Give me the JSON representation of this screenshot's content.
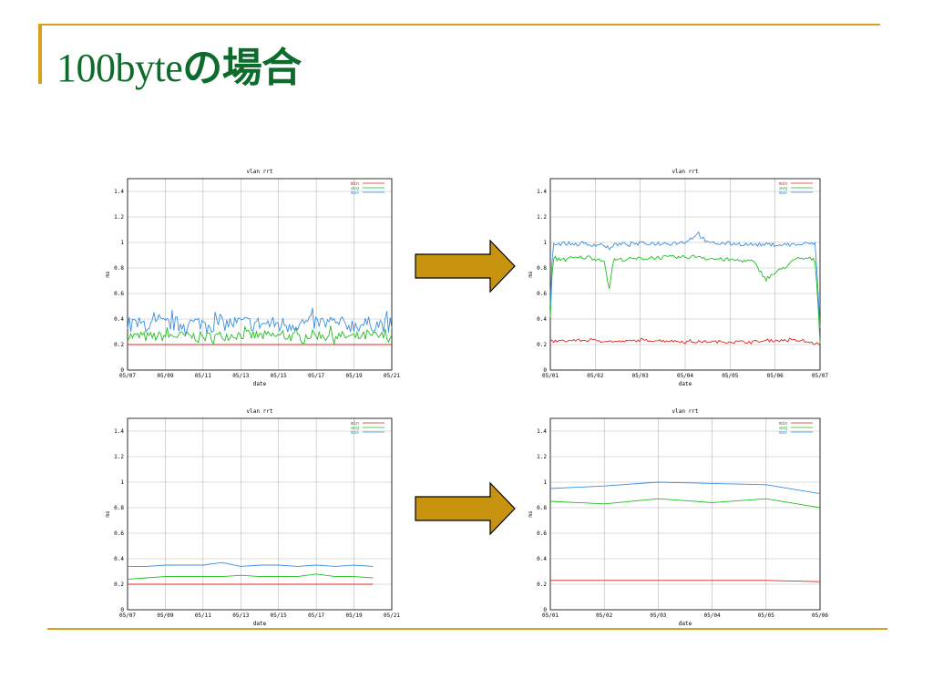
{
  "slide": {
    "title_latin": "100byte",
    "title_jp": "の場合"
  },
  "colors": {
    "accent": "#d6a21e",
    "title": "#0d6b2c",
    "arrow_fill": "#c8940f",
    "min": "#e0241f",
    "avg": "#1fbf1f",
    "max": "#3a8fe0"
  },
  "chart_data": [
    {
      "id": "top-left",
      "type": "line",
      "title": "vlan rrt",
      "xlabel": "date",
      "ylabel": "ms",
      "ylim": [
        0,
        1.5
      ],
      "yticks": [
        "0",
        "0.2",
        "0.4",
        "0.6",
        "0.8",
        "1",
        "1.2",
        "1.4"
      ],
      "xticks": [
        "05/07",
        "05/09",
        "05/11",
        "05/13",
        "05/15",
        "05/17",
        "05/19",
        "05/21"
      ],
      "xlim": [
        0,
        14
      ],
      "legend": [
        "min",
        "avg",
        "max"
      ],
      "legend_position": "top-right",
      "grid": true,
      "noisy": true,
      "series": [
        {
          "name": "min",
          "x": [
            0,
            14
          ],
          "values": [
            0.2,
            0.2
          ]
        },
        {
          "name": "avg",
          "x": [
            0,
            1,
            2,
            3,
            4,
            5,
            6,
            7,
            8,
            9,
            10,
            11,
            12,
            13,
            14
          ],
          "values": [
            0.26,
            0.25,
            0.26,
            0.26,
            0.25,
            0.26,
            0.27,
            0.26,
            0.26,
            0.25,
            0.27,
            0.26,
            0.25,
            0.26,
            0.25
          ],
          "jitter": 0.04
        },
        {
          "name": "max",
          "x": [
            0,
            1,
            2,
            3,
            4,
            5,
            6,
            7,
            8,
            9,
            10,
            11,
            12,
            13,
            14
          ],
          "values": [
            0.35,
            0.34,
            0.35,
            0.35,
            0.36,
            0.35,
            0.36,
            0.35,
            0.35,
            0.35,
            0.36,
            0.35,
            0.34,
            0.35,
            0.34
          ],
          "jitter": 0.06
        }
      ]
    },
    {
      "id": "top-right",
      "type": "line",
      "title": "vlan rrt",
      "xlabel": "date",
      "ylabel": "ms",
      "ylim": [
        0,
        1.5
      ],
      "yticks": [
        "0",
        "0.2",
        "0.4",
        "0.6",
        "0.8",
        "1",
        "1.2",
        "1.4"
      ],
      "xticks": [
        "05/01",
        "05/02",
        "05/03",
        "05/04",
        "05/05",
        "05/06",
        "05/07"
      ],
      "xlim": [
        0,
        6
      ],
      "legend": [
        "min",
        "avg",
        "max"
      ],
      "legend_position": "top-right",
      "grid": true,
      "noisy": true,
      "series": [
        {
          "name": "min",
          "x": [
            0,
            0.5,
            1,
            1.5,
            2,
            2.5,
            3,
            3.5,
            4,
            4.5,
            5,
            5.5,
            6
          ],
          "values": [
            0.22,
            0.23,
            0.23,
            0.22,
            0.23,
            0.23,
            0.22,
            0.22,
            0.22,
            0.22,
            0.23,
            0.23,
            0.2
          ],
          "jitter": 0.01
        },
        {
          "name": "avg",
          "x": [
            0,
            0.05,
            0.3,
            0.8,
            1.2,
            1.3,
            1.4,
            2,
            2.5,
            3,
            3.3,
            3.5,
            4,
            4.5,
            4.8,
            5.5,
            5.8,
            5.9,
            6
          ],
          "values": [
            0.4,
            0.86,
            0.87,
            0.88,
            0.86,
            0.61,
            0.86,
            0.87,
            0.88,
            0.88,
            0.89,
            0.87,
            0.86,
            0.85,
            0.71,
            0.87,
            0.87,
            0.85,
            0.22
          ],
          "jitter": 0.015
        },
        {
          "name": "max",
          "x": [
            0,
            0.05,
            0.3,
            0.8,
            1.2,
            1.3,
            1.4,
            2,
            2.5,
            3,
            3.3,
            3.5,
            4,
            4.5,
            5,
            5.5,
            5.8,
            5.9,
            6
          ],
          "values": [
            0.5,
            0.98,
            0.99,
            0.98,
            0.98,
            0.93,
            0.98,
            0.99,
            0.99,
            1.0,
            1.07,
            0.99,
            0.99,
            0.98,
            0.98,
            0.98,
            0.99,
            0.98,
            0.32
          ],
          "jitter": 0.015
        }
      ]
    },
    {
      "id": "bottom-left",
      "type": "line",
      "title": "vlan rrt",
      "xlabel": "date",
      "ylabel": "ms",
      "ylim": [
        0,
        1.5
      ],
      "yticks": [
        "0",
        "0.2",
        "0.4",
        "0.6",
        "0.8",
        "1",
        "1.2",
        "1.4"
      ],
      "xticks": [
        "05/07",
        "05/09",
        "05/11",
        "05/13",
        "05/15",
        "05/17",
        "05/19",
        "05/21"
      ],
      "xlim": [
        0,
        14
      ],
      "legend": [
        "min",
        "avg",
        "max"
      ],
      "legend_position": "top-right",
      "grid": true,
      "noisy": false,
      "series": [
        {
          "name": "min",
          "x": [
            0,
            13
          ],
          "values": [
            0.2,
            0.2
          ]
        },
        {
          "name": "avg",
          "x": [
            0,
            1,
            2,
            3,
            4,
            5,
            6,
            7,
            8,
            9,
            10,
            11,
            12,
            13
          ],
          "values": [
            0.24,
            0.25,
            0.26,
            0.26,
            0.26,
            0.26,
            0.27,
            0.26,
            0.26,
            0.26,
            0.28,
            0.26,
            0.26,
            0.25
          ]
        },
        {
          "name": "max",
          "x": [
            0,
            1,
            2,
            3,
            4,
            5,
            6,
            7,
            8,
            9,
            10,
            11,
            12,
            13
          ],
          "values": [
            0.34,
            0.34,
            0.35,
            0.35,
            0.35,
            0.37,
            0.34,
            0.35,
            0.35,
            0.34,
            0.35,
            0.34,
            0.35,
            0.34
          ]
        }
      ]
    },
    {
      "id": "bottom-right",
      "type": "line",
      "title": "vlan rrt",
      "xlabel": "date",
      "ylabel": "ms",
      "ylim": [
        0,
        1.5
      ],
      "yticks": [
        "0",
        "0.2",
        "0.4",
        "0.6",
        "0.8",
        "1",
        "1.2",
        "1.4"
      ],
      "xticks": [
        "05/01",
        "05/02",
        "05/03",
        "05/04",
        "05/05",
        "05/06"
      ],
      "xlim": [
        0,
        5
      ],
      "legend": [
        "min",
        "avg",
        "max"
      ],
      "legend_position": "top-right",
      "grid": true,
      "noisy": false,
      "series": [
        {
          "name": "min",
          "x": [
            0,
            1,
            2,
            3,
            4,
            5
          ],
          "values": [
            0.23,
            0.23,
            0.23,
            0.23,
            0.23,
            0.22
          ]
        },
        {
          "name": "avg",
          "x": [
            0,
            1,
            2,
            3,
            4,
            5
          ],
          "values": [
            0.85,
            0.83,
            0.87,
            0.84,
            0.87,
            0.8
          ]
        },
        {
          "name": "max",
          "x": [
            0,
            1,
            2,
            3,
            4,
            5
          ],
          "values": [
            0.95,
            0.97,
            1.0,
            0.99,
            0.98,
            0.91
          ]
        }
      ]
    }
  ]
}
